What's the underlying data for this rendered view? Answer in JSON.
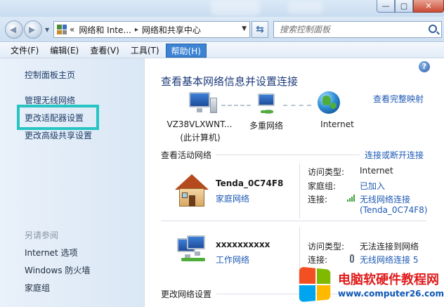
{
  "window": {
    "minimize_glyph": "—",
    "maximize_glyph": "▢",
    "close_glyph": "✕"
  },
  "navbar": {
    "back_glyph": "◀",
    "forward_glyph": "▶",
    "breadcrumb_prefix": "«",
    "breadcrumbs": [
      "网络和 Inte...",
      "网络和共享中心"
    ],
    "breadcrumb_sep": "▸",
    "search_placeholder": "搜索控制面板"
  },
  "menubar": {
    "items": [
      "文件(F)",
      "编辑(E)",
      "查看(V)",
      "工具(T)",
      "帮助(H)"
    ],
    "active": "帮助(H)"
  },
  "sidebar": {
    "home": "控制面板主页",
    "items": [
      "管理无线网络",
      "更改适配器设置",
      "更改高级共享设置"
    ],
    "see_also_heading": "另请参阅",
    "see_also": [
      "Internet 选项",
      "Windows 防火墙",
      "家庭组"
    ]
  },
  "main": {
    "help_glyph": "?",
    "title": "查看基本网络信息并设置连接",
    "full_map_link": "查看完整映射",
    "map": {
      "computer_name": "VZ38VLXWNT...",
      "computer_sub": "(此计算机)",
      "middle": "多重网络",
      "internet": "Internet"
    },
    "active_networks_label": "查看活动网络",
    "connect_link": "连接或断开连接",
    "networks": [
      {
        "name": "Tenda_0C74F8",
        "type": "家庭网络",
        "access_type_key": "访问类型:",
        "access_type_val": "Internet",
        "homegroup_key": "家庭组:",
        "homegroup_val": "已加入",
        "connection_key": "连接:",
        "connection_val": "无线网络连接",
        "connection_sub": "(Tenda_0C74F8)"
      },
      {
        "name": "xxxxxxxxxx",
        "type": "工作网络",
        "access_type_key": "访问类型:",
        "access_type_val": "无法连接到网络",
        "connection_key": "连接:",
        "connection_val": "无线网络连接 5"
      }
    ],
    "change_settings_label": "更改网络设置"
  },
  "watermark": {
    "title": "电脑软硬件教程网",
    "url": "www.computer26.com"
  }
}
